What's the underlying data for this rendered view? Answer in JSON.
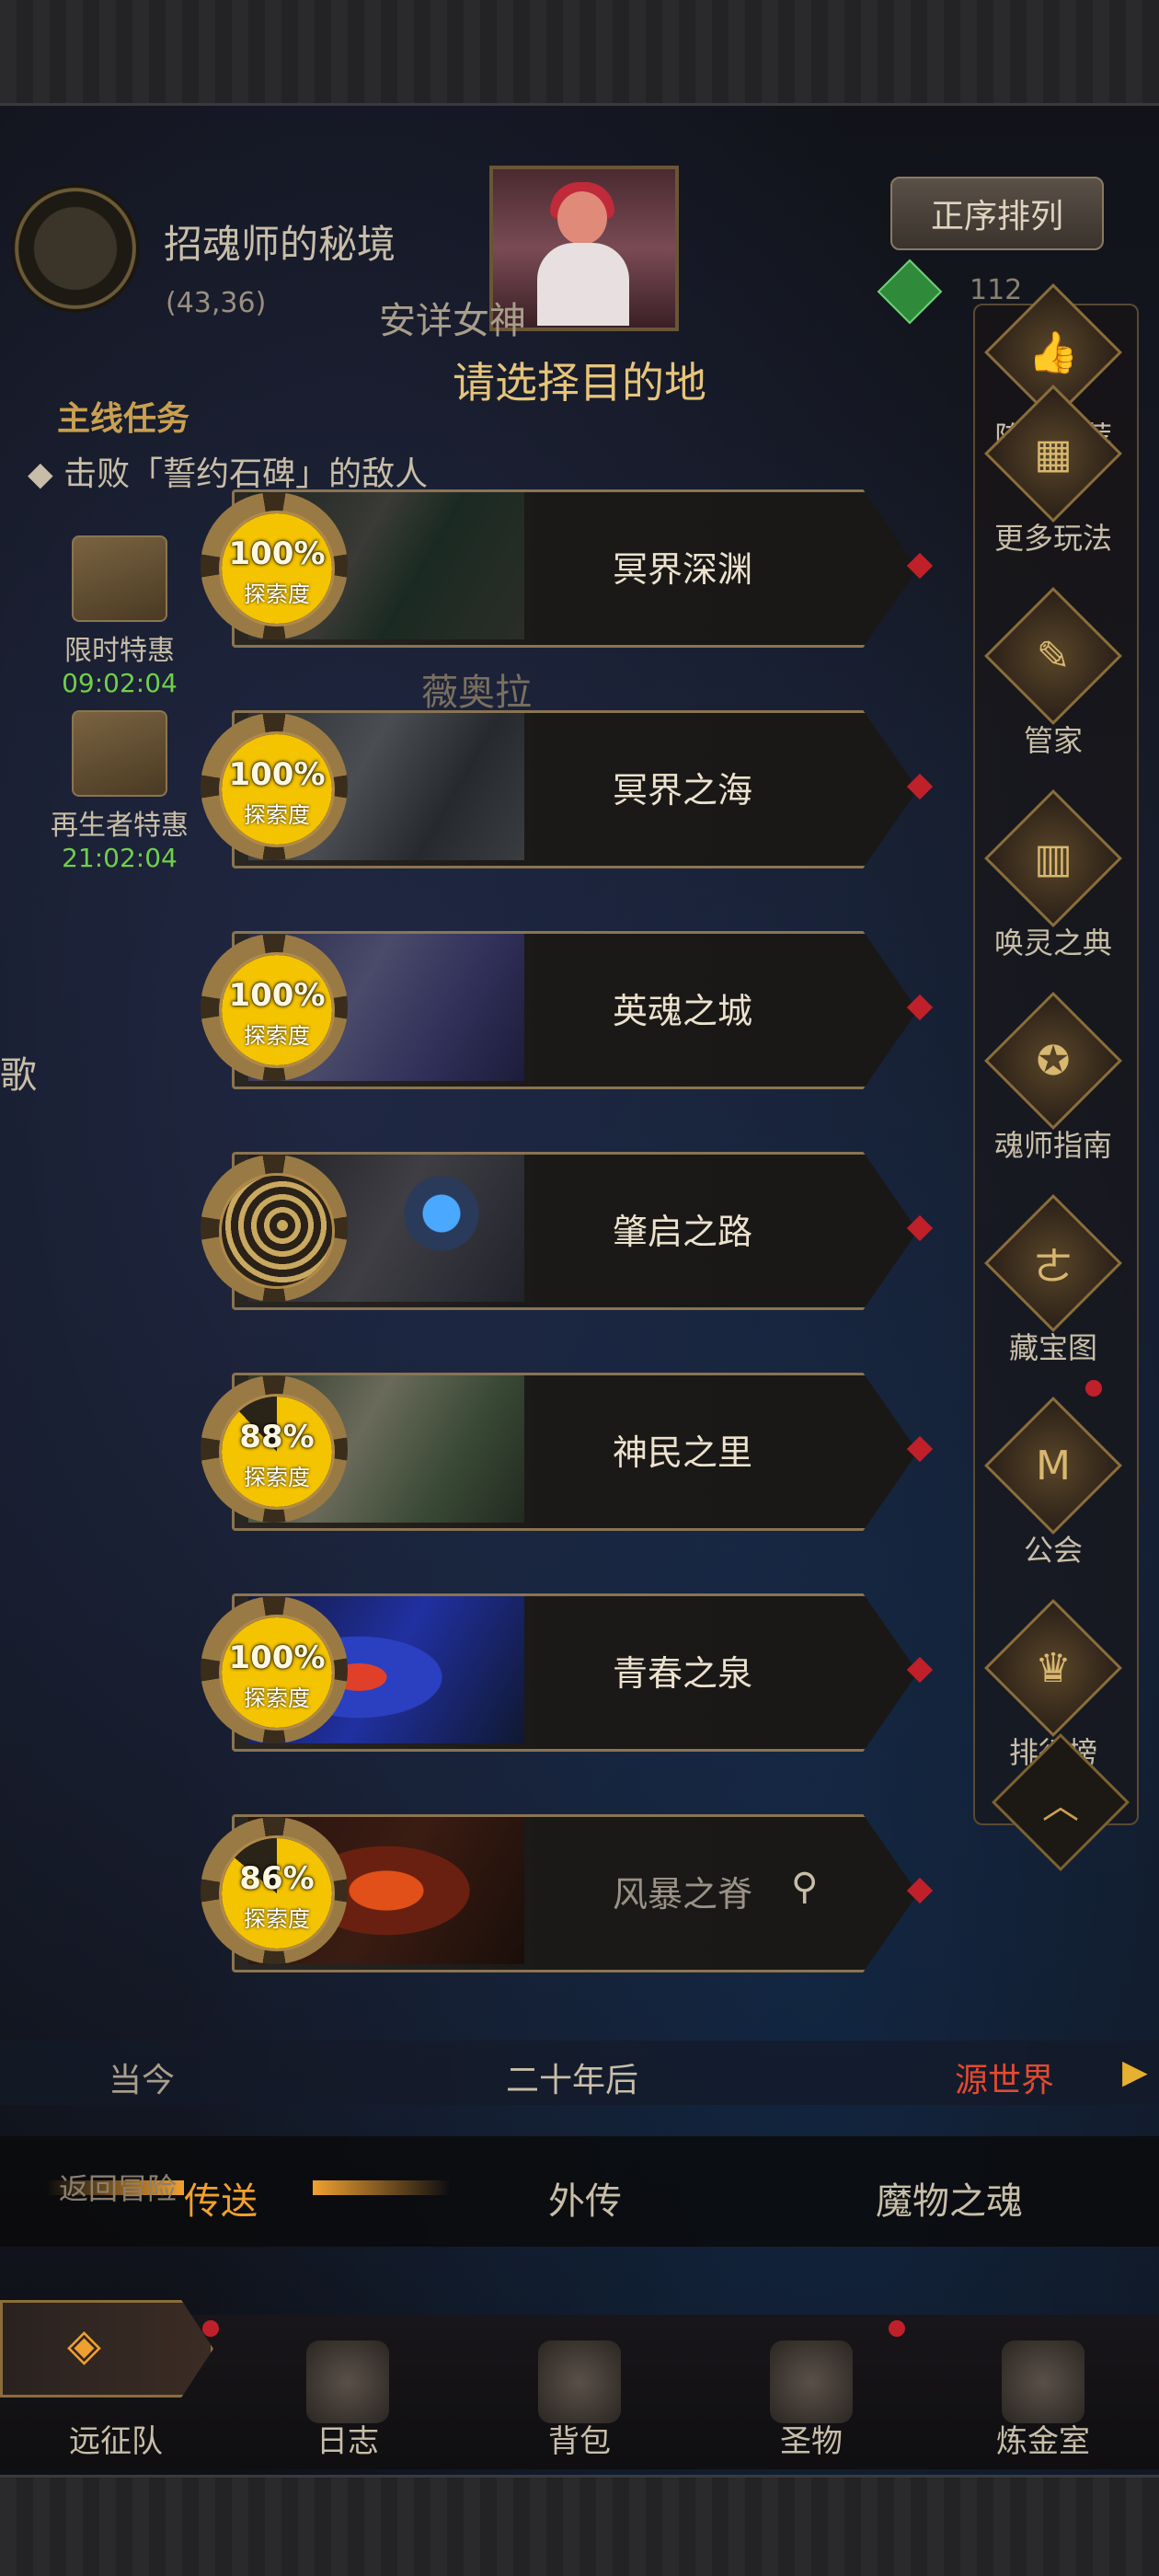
{
  "hud": {
    "location_title": "招魂师的秘境",
    "coords": "(43,36)",
    "npc_name": "安详女神",
    "gem_count": "112",
    "sort_button": "正序排列",
    "select_title": "请选择目的地",
    "quest_header": "主线任务",
    "quest_text": "击败「誓约石碑」的敌人",
    "npc_below": "薇奥拉",
    "song_fragment": "歌",
    "adventure_label": "返回冒险"
  },
  "offers": [
    {
      "label": "限时特惠",
      "time": "09:02:04"
    },
    {
      "label": "再生者特惠",
      "time": "21:02:04"
    }
  ],
  "right_menu": [
    {
      "label": "阵容推荐",
      "icon": "thumbs-up-icon",
      "glyph": "👍"
    },
    {
      "label": "更多玩法",
      "icon": "gift-icon",
      "glyph": "▦"
    },
    {
      "label": "管家",
      "icon": "scroll-icon",
      "glyph": "✎"
    },
    {
      "label": "唤灵之典",
      "icon": "book-icon",
      "glyph": "▥"
    },
    {
      "label": "魂师指南",
      "icon": "guide-icon",
      "glyph": "✪"
    },
    {
      "label": "藏宝图",
      "icon": "treasure-map-icon",
      "glyph": "ㄜ"
    },
    {
      "label": "公会",
      "icon": "guild-icon",
      "glyph": "M"
    },
    {
      "label": "排行榜",
      "icon": "trophy-icon",
      "glyph": "♛"
    }
  ],
  "destinations": [
    {
      "name": "冥界深渊",
      "progress_text": "100%",
      "progress": 1.0,
      "sub": "探索度"
    },
    {
      "name": "冥界之海",
      "progress_text": "100%",
      "progress": 1.0,
      "sub": "探索度"
    },
    {
      "name": "英魂之城",
      "progress_text": "100%",
      "progress": 1.0,
      "sub": "探索度"
    },
    {
      "name": "肇启之路",
      "progress_text": "",
      "progress": null,
      "sub": ""
    },
    {
      "name": "神民之里",
      "progress_text": "88%",
      "progress": 0.88,
      "sub": "探索度"
    },
    {
      "name": "青春之泉",
      "progress_text": "100%",
      "progress": 1.0,
      "sub": "探索度"
    },
    {
      "name": "风暴之脊",
      "progress_text": "86%",
      "progress": 0.86,
      "sub": "探索度",
      "current": true
    }
  ],
  "eras": {
    "now": "当今",
    "later": "二十年后",
    "origin": "源世界"
  },
  "tabs": {
    "teleport": "传送",
    "side_story": "外传",
    "monster_soul": "魔物之魂"
  },
  "nav": [
    {
      "label": "远征队",
      "icon": "expedition-icon"
    },
    {
      "label": "日志",
      "icon": "journal-icon"
    },
    {
      "label": "背包",
      "icon": "backpack-icon"
    },
    {
      "label": "圣物",
      "icon": "relic-icon"
    },
    {
      "label": "炼金室",
      "icon": "alchemy-icon"
    }
  ],
  "colors": {
    "accent": "#f0a030",
    "gold": "#c9a050",
    "progress_fill": "#f5c400",
    "notify": "#c0202a",
    "timer": "#6fcf4c"
  }
}
